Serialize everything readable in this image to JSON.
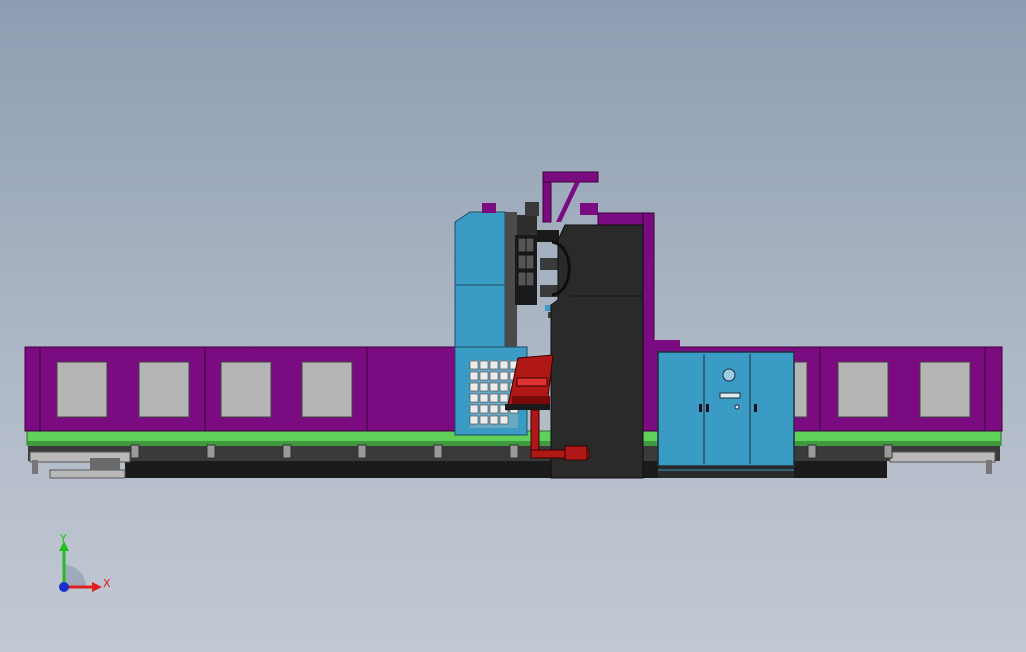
{
  "triad": {
    "x_label": "X",
    "y_label": "Y",
    "x_color": "#e02020",
    "y_color": "#20c020",
    "z_color": "#1a2fd0"
  },
  "model_colors": {
    "background_top": "#8d9db1",
    "background_bottom": "#c3c9d3",
    "enclosure_purple": "#7a0b80",
    "rail_green": "#5fd15a",
    "window_gray": "#b5b5b5",
    "cabinet_blue": "#3a9bc4",
    "column_dark": "#2a2a2a",
    "operator_panel_red": "#b01818"
  }
}
